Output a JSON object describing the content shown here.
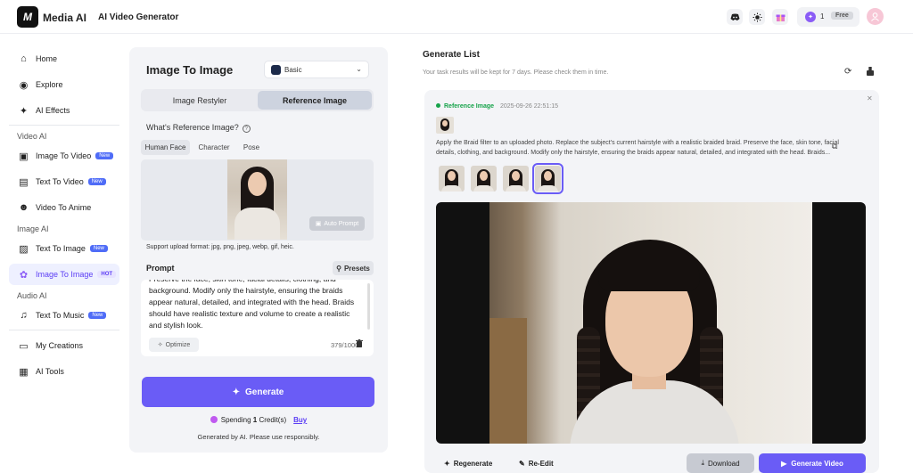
{
  "header": {
    "logo_text": "M",
    "brand": "Media AI",
    "tool_name": "AI Video Generator",
    "credits": "1",
    "plan_badge": "Free",
    "icons": [
      "discord-icon",
      "sun-icon",
      "gift-icon"
    ]
  },
  "sidebar": {
    "items": [
      {
        "label": "Home"
      },
      {
        "label": "Explore"
      },
      {
        "label": "AI Effects"
      },
      {
        "label": "Image To Video",
        "badge": "New"
      },
      {
        "label": "Text To Video",
        "badge": "New"
      },
      {
        "label": "Video To Anime"
      },
      {
        "label": "Text To Image",
        "badge": "New"
      },
      {
        "label": "Image To Image",
        "badge": "HOT"
      },
      {
        "label": "Text To Music",
        "badge": "New"
      },
      {
        "label": "My Creations"
      },
      {
        "label": "AI Tools"
      }
    ],
    "sections": {
      "video": "Video AI",
      "image": "Image AI",
      "audio": "Audio AI"
    }
  },
  "panel": {
    "title": "Image To Image",
    "model": "Basic",
    "modes": [
      "Image Restyler",
      "Reference Image"
    ],
    "question": "What's Reference Image?",
    "sub_tabs": [
      "Human Face",
      "Character",
      "Pose"
    ],
    "auto_prompt": "Auto Prompt",
    "support_formats": "Support upload format: jpg, png, jpeg, webp, gif, heic.",
    "prompt_label": "Prompt",
    "presets_label": "Presets",
    "prompt_text": "Preserve the face, skin tone, facial details, clothing, and background. Modify only the hairstyle, ensuring the braids appear natural, detailed, and integrated with the head. Braids should have realistic texture and volume to create a realistic and stylish look.",
    "optimize_label": "Optimize",
    "char_count": "379/1000",
    "generate_label": "Generate",
    "spending_prefix": "Spending ",
    "spending_amount": "1",
    "spending_suffix": " Credit(s)",
    "buy_label": "Buy",
    "notice": "Generated by AI. Please use responsibly."
  },
  "generate_list": {
    "title": "Generate List",
    "subtitle": "Your task results will be kept for 7 days. Please check them in time.",
    "card": {
      "tag": "Reference Image",
      "timestamp": "2025-09-26 22:51:15",
      "description": "Apply the Braid filter to an uploaded photo. Replace the subject's current hairstyle with a realistic braided braid. Preserve the face, skin tone, facial details, clothing, and background. Modify only the hairstyle, ensuring the braids appear natural, detailed, and integrated with the head. Braids...",
      "actions": {
        "regenerate": "Regenerate",
        "reedit": "Re-Edit",
        "download": "Download",
        "generate_video": "Generate Video"
      }
    }
  }
}
